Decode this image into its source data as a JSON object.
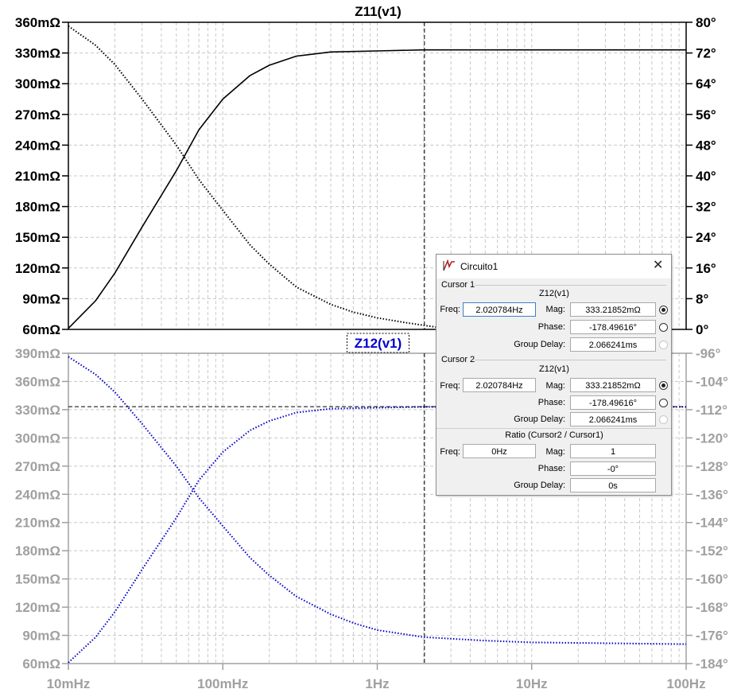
{
  "chart_data": [
    {
      "type": "line",
      "title": "Z11(v1)",
      "x_scale": "log",
      "x_ticks": [
        "10mHz",
        "100mHz",
        "1Hz",
        "10Hz",
        "100Hz"
      ],
      "x_range_hz": [
        0.01,
        100
      ],
      "left_axis": {
        "unit": "mΩ",
        "range": [
          60,
          360
        ],
        "ticks": [
          "360mΩ",
          "330mΩ",
          "300mΩ",
          "270mΩ",
          "240mΩ",
          "210mΩ",
          "180mΩ",
          "150mΩ",
          "120mΩ",
          "90mΩ",
          "60mΩ"
        ]
      },
      "right_axis": {
        "unit": "°",
        "range": [
          0,
          80
        ],
        "ticks": [
          "80°",
          "72°",
          "64°",
          "56°",
          "48°",
          "40°",
          "32°",
          "24°",
          "16°",
          "8°",
          "0°"
        ]
      },
      "grid": true,
      "color": "#000000",
      "series": [
        {
          "line_style": "solid",
          "axis": "left",
          "x": [
            0.01,
            0.015,
            0.02,
            0.03,
            0.05,
            0.07,
            0.1,
            0.15,
            0.2,
            0.3,
            0.5,
            1,
            2,
            10,
            100
          ],
          "y": [
            61,
            88,
            115,
            160,
            215,
            255,
            285,
            308,
            318,
            327,
            331,
            332,
            333,
            333,
            333
          ]
        },
        {
          "line_style": "dotted",
          "axis": "right",
          "x": [
            0.01,
            0.015,
            0.02,
            0.03,
            0.05,
            0.07,
            0.1,
            0.15,
            0.2,
            0.3,
            0.5,
            0.7,
            1,
            1.5,
            2.5
          ],
          "y": [
            79,
            74,
            69,
            60,
            48,
            39,
            31,
            22,
            17,
            11,
            6.5,
            4.5,
            3,
            1.8,
            0.5
          ]
        }
      ]
    },
    {
      "type": "line",
      "title": "Z12(v1)",
      "x_scale": "log",
      "x_ticks": [
        "10mHz",
        "100mHz",
        "1Hz",
        "10Hz",
        "100Hz"
      ],
      "x_range_hz": [
        0.01,
        100
      ],
      "left_axis": {
        "unit": "mΩ",
        "range": [
          60,
          390
        ],
        "ticks": [
          "390mΩ",
          "360mΩ",
          "330mΩ",
          "300mΩ",
          "270mΩ",
          "240mΩ",
          "210mΩ",
          "180mΩ",
          "150mΩ",
          "120mΩ",
          "90mΩ",
          "60mΩ"
        ]
      },
      "right_axis": {
        "unit": "°",
        "range": [
          -184,
          -96
        ],
        "ticks": [
          "-96°",
          "-104°",
          "-112°",
          "-120°",
          "-128°",
          "-136°",
          "-144°",
          "-152°",
          "-160°",
          "-168°",
          "-176°",
          "-184°"
        ]
      },
      "grid": true,
      "color": "#0000cc",
      "series": [
        {
          "line_style": "dotted",
          "axis": "left",
          "x": [
            0.01,
            0.015,
            0.02,
            0.03,
            0.05,
            0.07,
            0.1,
            0.15,
            0.2,
            0.3,
            0.5,
            1,
            2,
            10,
            100
          ],
          "y": [
            61,
            88,
            115,
            160,
            215,
            255,
            285,
            308,
            318,
            327,
            331,
            332,
            333,
            333,
            333
          ]
        },
        {
          "line_style": "dotted",
          "axis": "right",
          "x": [
            0.01,
            0.015,
            0.02,
            0.03,
            0.05,
            0.07,
            0.1,
            0.15,
            0.2,
            0.3,
            0.5,
            0.7,
            1,
            2,
            5,
            10,
            100
          ],
          "y": [
            -97,
            -102,
            -107,
            -116,
            -128,
            -137,
            -145,
            -154,
            -159,
            -165,
            -170,
            -172.5,
            -174.5,
            -176.5,
            -177.5,
            -178,
            -178.5
          ]
        }
      ]
    }
  ],
  "cursor": {
    "freq_hz": 2.020784,
    "mag_mohm": 333.21852
  },
  "dialog": {
    "title": "Circuito1",
    "close_glyph": "✕",
    "cursor1": {
      "header": "Cursor 1",
      "trace": "Z12(v1)",
      "freq_label": "Freq:",
      "freq_value": "2.020784Hz",
      "mag_label": "Mag:",
      "mag_value": "333.21852mΩ",
      "phase_label": "Phase:",
      "phase_value": "-178.49616°",
      "gd_label": "Group Delay:",
      "gd_value": "2.066241ms"
    },
    "cursor2": {
      "header": "Cursor 2",
      "trace": "Z12(v1)",
      "freq_label": "Freq:",
      "freq_value": "2.020784Hz",
      "mag_label": "Mag:",
      "mag_value": "333.21852mΩ",
      "phase_label": "Phase:",
      "phase_value": "-178.49616°",
      "gd_label": "Group Delay:",
      "gd_value": "2.066241ms"
    },
    "ratio": {
      "header": "Ratio (Cursor2 / Cursor1)",
      "freq_label": "Freq:",
      "freq_value": "0Hz",
      "mag_label": "Mag:",
      "mag_value": "1",
      "phase_label": "Phase:",
      "phase_value": "-0°",
      "gd_label": "Group Delay:",
      "gd_value": "0s"
    },
    "selected_radio": "mag"
  }
}
